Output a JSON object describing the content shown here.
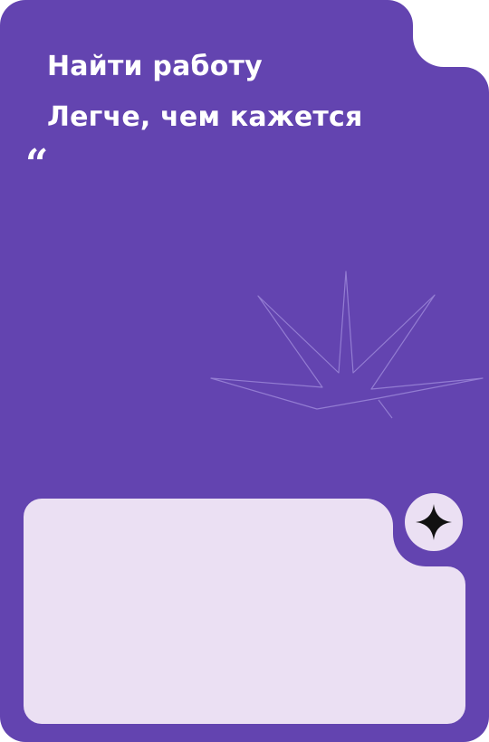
{
  "card": {
    "title": "Найти работу",
    "subtitle": "Легче, чем кажется",
    "quote_mark": "“",
    "background_color": "#6344b0",
    "panel_color": "#ebe0f3",
    "decoration_icon": "starburst-icon",
    "action_icon": "sparkle-icon"
  }
}
